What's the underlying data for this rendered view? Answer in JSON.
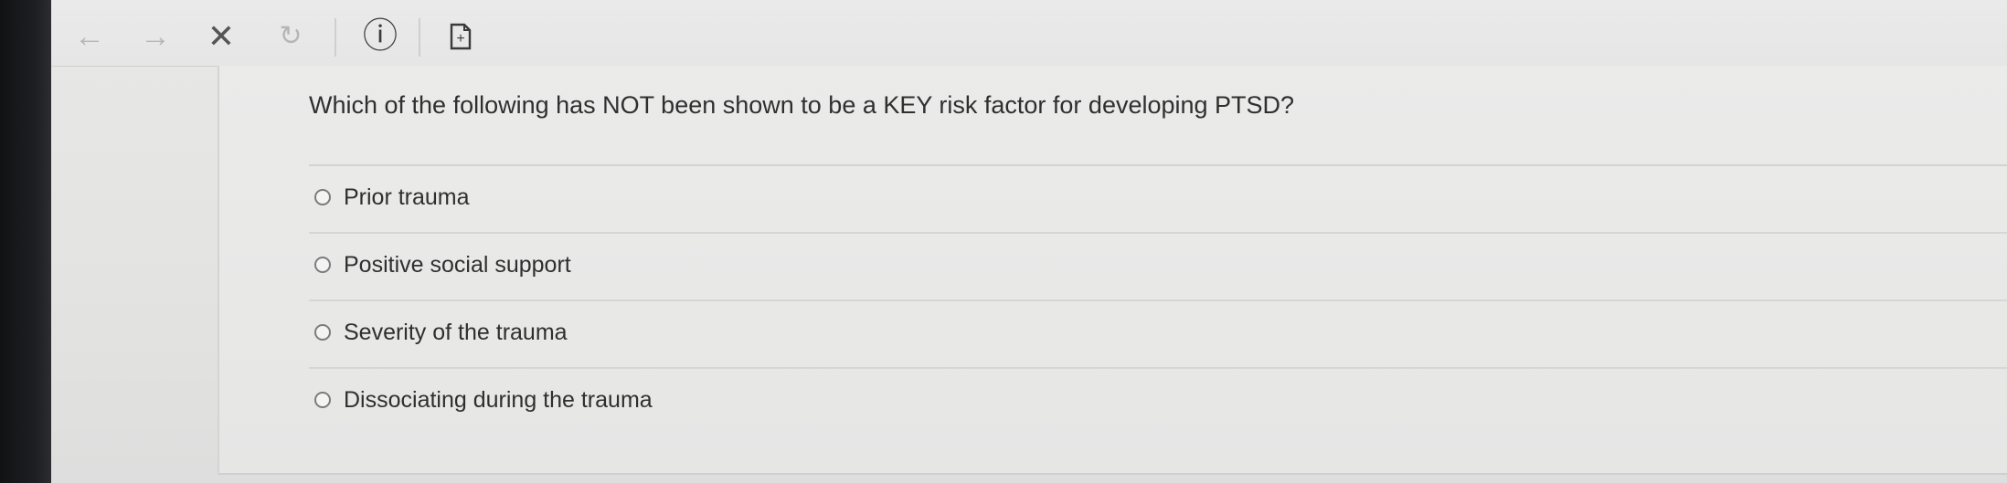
{
  "toolbar": {
    "back": "←",
    "forward": "→",
    "stop": "✕",
    "refresh": "↻",
    "info": "ⓘ",
    "add_page": "+"
  },
  "question": {
    "text": "Which of the following has NOT been shown to be a KEY risk factor for developing PTSD?",
    "options": [
      {
        "label": "Prior trauma",
        "selected": false
      },
      {
        "label": "Positive social support",
        "selected": false
      },
      {
        "label": "Severity of the trauma",
        "selected": false
      },
      {
        "label": "Dissociating during the trauma",
        "selected": false
      }
    ]
  },
  "colors": {
    "accent_strip": "#5d8bc4",
    "text": "#2f2f2f",
    "background": "#e6e6e5"
  }
}
